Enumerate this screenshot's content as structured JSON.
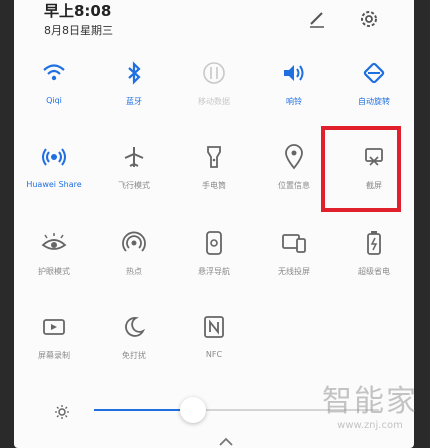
{
  "status": {
    "time": "早上8:08",
    "date": "8月8日星期三"
  },
  "tiles": [
    {
      "label": "Qiqi",
      "icon": "wifi-icon",
      "state": "on"
    },
    {
      "label": "蓝牙",
      "icon": "bluetooth-icon",
      "state": "on"
    },
    {
      "label": "移动数据",
      "icon": "mobile-data-icon",
      "state": "off"
    },
    {
      "label": "响铃",
      "icon": "sound-icon",
      "state": "on"
    },
    {
      "label": "自动旋转",
      "icon": "auto-rotate-icon",
      "state": "on"
    },
    {
      "label": "Huawei Share",
      "icon": "huawei-share-icon",
      "state": "on"
    },
    {
      "label": "飞行模式",
      "icon": "airplane-icon",
      "state": "off"
    },
    {
      "label": "手电筒",
      "icon": "flashlight-icon",
      "state": "off"
    },
    {
      "label": "位置信息",
      "icon": "location-icon",
      "state": "off"
    },
    {
      "label": "截屏",
      "icon": "screenshot-icon",
      "state": "off"
    },
    {
      "label": "护眼模式",
      "icon": "eye-comfort-icon",
      "state": "off"
    },
    {
      "label": "热点",
      "icon": "hotspot-icon",
      "state": "off"
    },
    {
      "label": "悬浮导航",
      "icon": "floating-nav-icon",
      "state": "off"
    },
    {
      "label": "无线投屏",
      "icon": "wireless-projection-icon",
      "state": "off"
    },
    {
      "label": "超级省电",
      "icon": "ultra-power-saving-icon",
      "state": "off"
    },
    {
      "label": "屏幕录制",
      "icon": "screen-record-icon",
      "state": "off"
    },
    {
      "label": "免打扰",
      "icon": "do-not-disturb-icon",
      "state": "off"
    },
    {
      "label": "NFC",
      "icon": "nfc-icon",
      "state": "off"
    }
  ],
  "brightness": {
    "level": 0.28
  },
  "watermark": {
    "text": "智能家",
    "url": "www.znj.com"
  },
  "colors": {
    "accent": "#1f6fe0",
    "inactive": "#8a8a8a",
    "highlight": "#e0202a"
  }
}
